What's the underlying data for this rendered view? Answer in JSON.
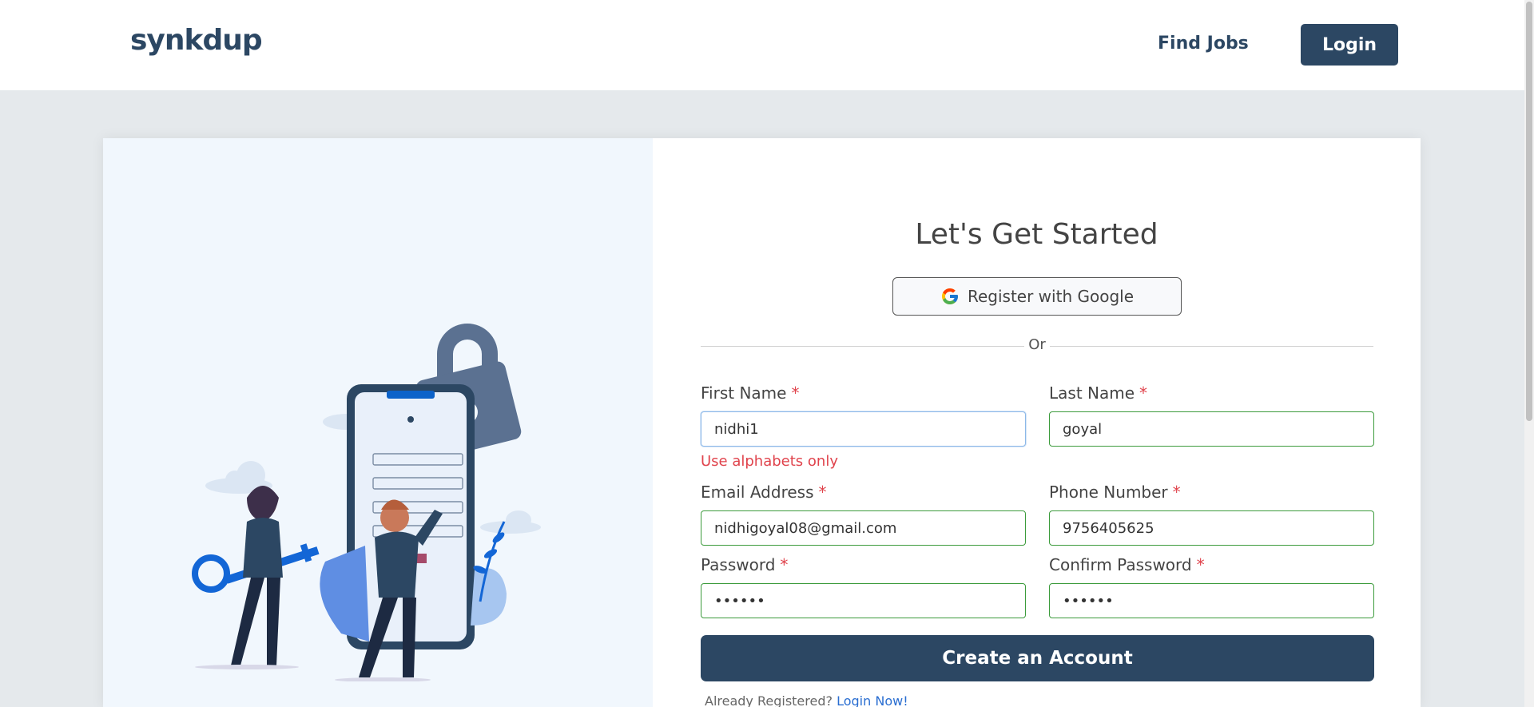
{
  "header": {
    "logo": "synkdup",
    "nav_find_jobs": "Find Jobs",
    "nav_login": "Login"
  },
  "form": {
    "title": "Let's Get Started",
    "google_button": "Register with Google",
    "or": "Or",
    "first_name": {
      "label": "First Name",
      "required": "*",
      "value": "nidhi1",
      "error": "Use alphabets only"
    },
    "last_name": {
      "label": "Last Name",
      "required": "*",
      "value": "goyal"
    },
    "email": {
      "label": "Email Address",
      "required": "*",
      "value": "nidhigoyal08@gmail.com"
    },
    "phone": {
      "label": "Phone Number",
      "required": "*",
      "value": "9756405625"
    },
    "password": {
      "label": "Password",
      "required": "*",
      "value": "••••••"
    },
    "confirm_password": {
      "label": "Confirm Password",
      "required": "*",
      "value": "••••••"
    },
    "submit": "Create an Account",
    "already_text": "Already Registered?",
    "login_now": "Login Now!"
  },
  "colors": {
    "brand": "#2c4763",
    "valid_border": "#3c9b3c",
    "error": "#e0434c",
    "link": "#2a6ed1"
  },
  "icons": [
    "google-icon",
    "padlock-icon"
  ]
}
